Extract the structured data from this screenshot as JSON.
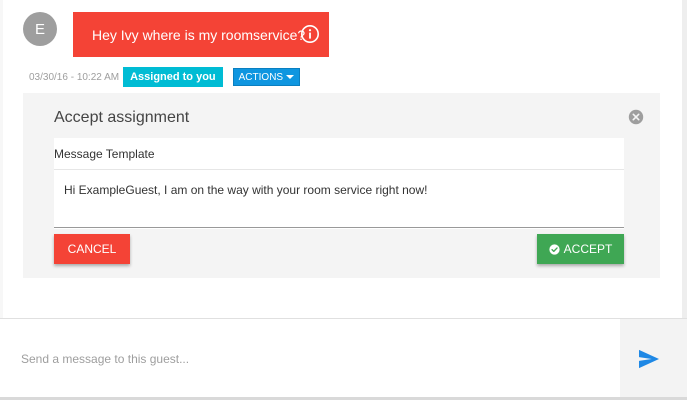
{
  "chat": {
    "avatar_initial": "E",
    "message_text": "Hey Ivy where is my roomservice?",
    "timestamp": "03/30/16 - 10:22 AM",
    "assigned_badge": "Assigned to you",
    "actions_label": "ACTIONS"
  },
  "assignment_panel": {
    "title": "Accept assignment",
    "template_label": "Message Template",
    "template_text": "Hi ExampleGuest, I am on the way with your room service right now!",
    "cancel_label": "CANCEL",
    "accept_label": "ACCEPT"
  },
  "composer": {
    "placeholder": "Send a message to this guest..."
  },
  "colors": {
    "message_bubble": "#f44336",
    "assigned_badge": "#00bcd4",
    "actions_button": "#0f96e0",
    "cancel_button": "#f44336",
    "accept_button": "#3fa754",
    "send_icon": "#1e88e5"
  },
  "icons": {
    "info": "info-circle-icon",
    "close": "close-circle-icon",
    "accept": "check-circle-icon",
    "send": "send-icon",
    "dropdown": "caret-down-icon"
  }
}
